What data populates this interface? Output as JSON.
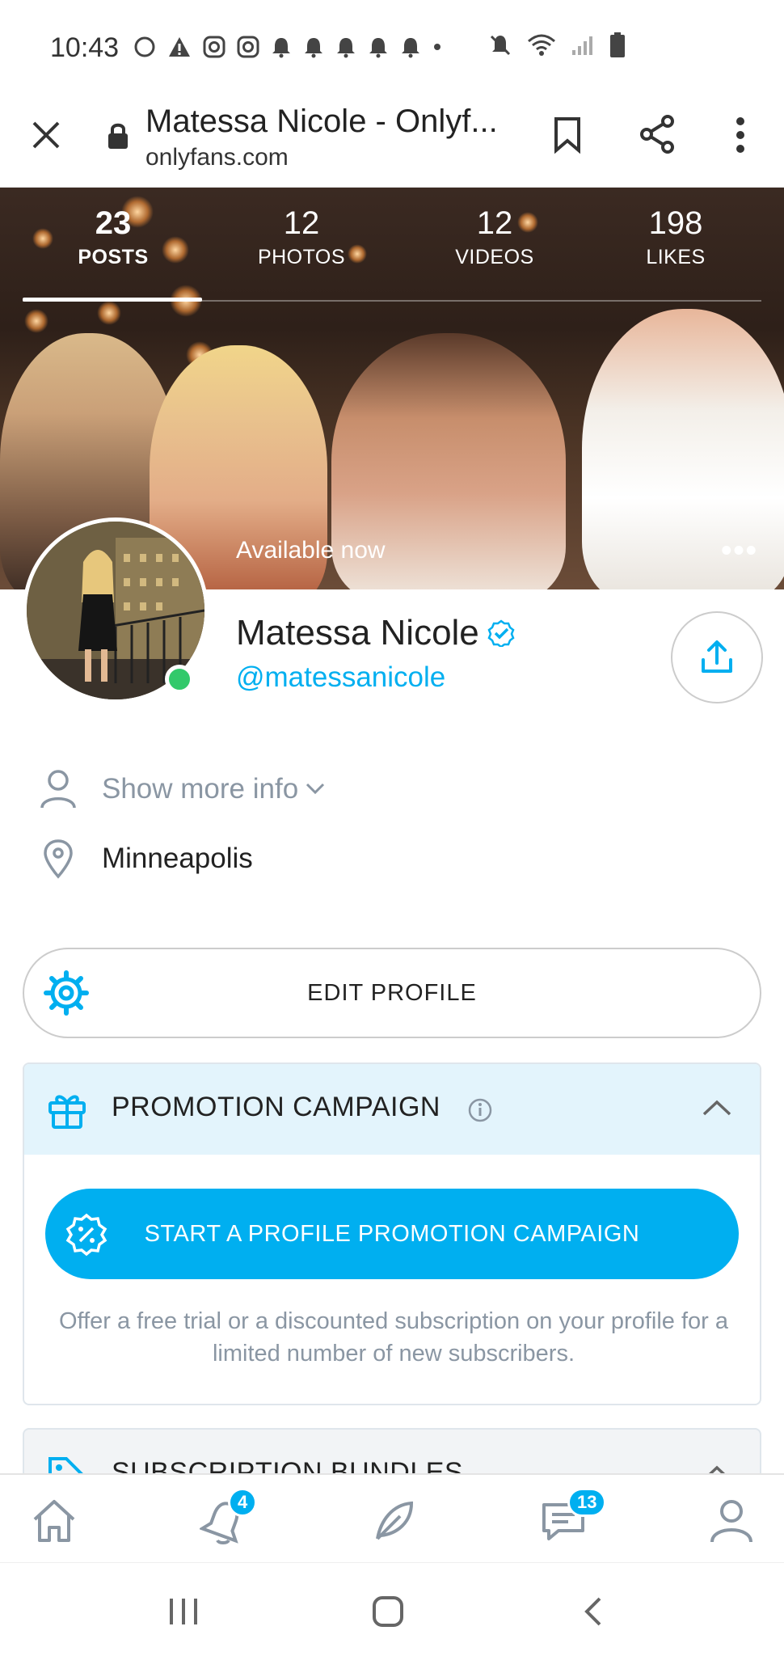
{
  "status_bar": {
    "time": "10:43"
  },
  "browser": {
    "title": "Matessa Nicole - Onlyf...",
    "domain": "onlyfans.com"
  },
  "profile_tabs": [
    {
      "count": "23",
      "label": "POSTS",
      "active": true
    },
    {
      "count": "12",
      "label": "PHOTOS",
      "active": false
    },
    {
      "count": "12",
      "label": "VIDEOS",
      "active": false
    },
    {
      "count": "198",
      "label": "LIKES",
      "active": false
    }
  ],
  "hero": {
    "availability": "Available now",
    "more_symbol": "•••"
  },
  "profile": {
    "name": "Matessa Nicole",
    "handle": "@matessanicole"
  },
  "info": {
    "show_more": "Show more info",
    "location": "Minneapolis"
  },
  "edit_profile": {
    "label": "EDIT PROFILE"
  },
  "promotion": {
    "title": "PROMOTION CAMPAIGN",
    "button": "START A PROFILE PROMOTION CAMPAIGN",
    "description": "Offer a free trial or a discounted subscription on your profile for a limited number of new subscribers."
  },
  "bundles": {
    "title": "SUBSCRIPTION BUNDLES"
  },
  "bottom_nav": {
    "notifications_badge": "4",
    "messages_badge": "13"
  },
  "colors": {
    "accent": "#00aff0",
    "online": "#32c96b",
    "promo_header_bg": "#e3f4fc",
    "muted_text": "#8a96a3"
  }
}
